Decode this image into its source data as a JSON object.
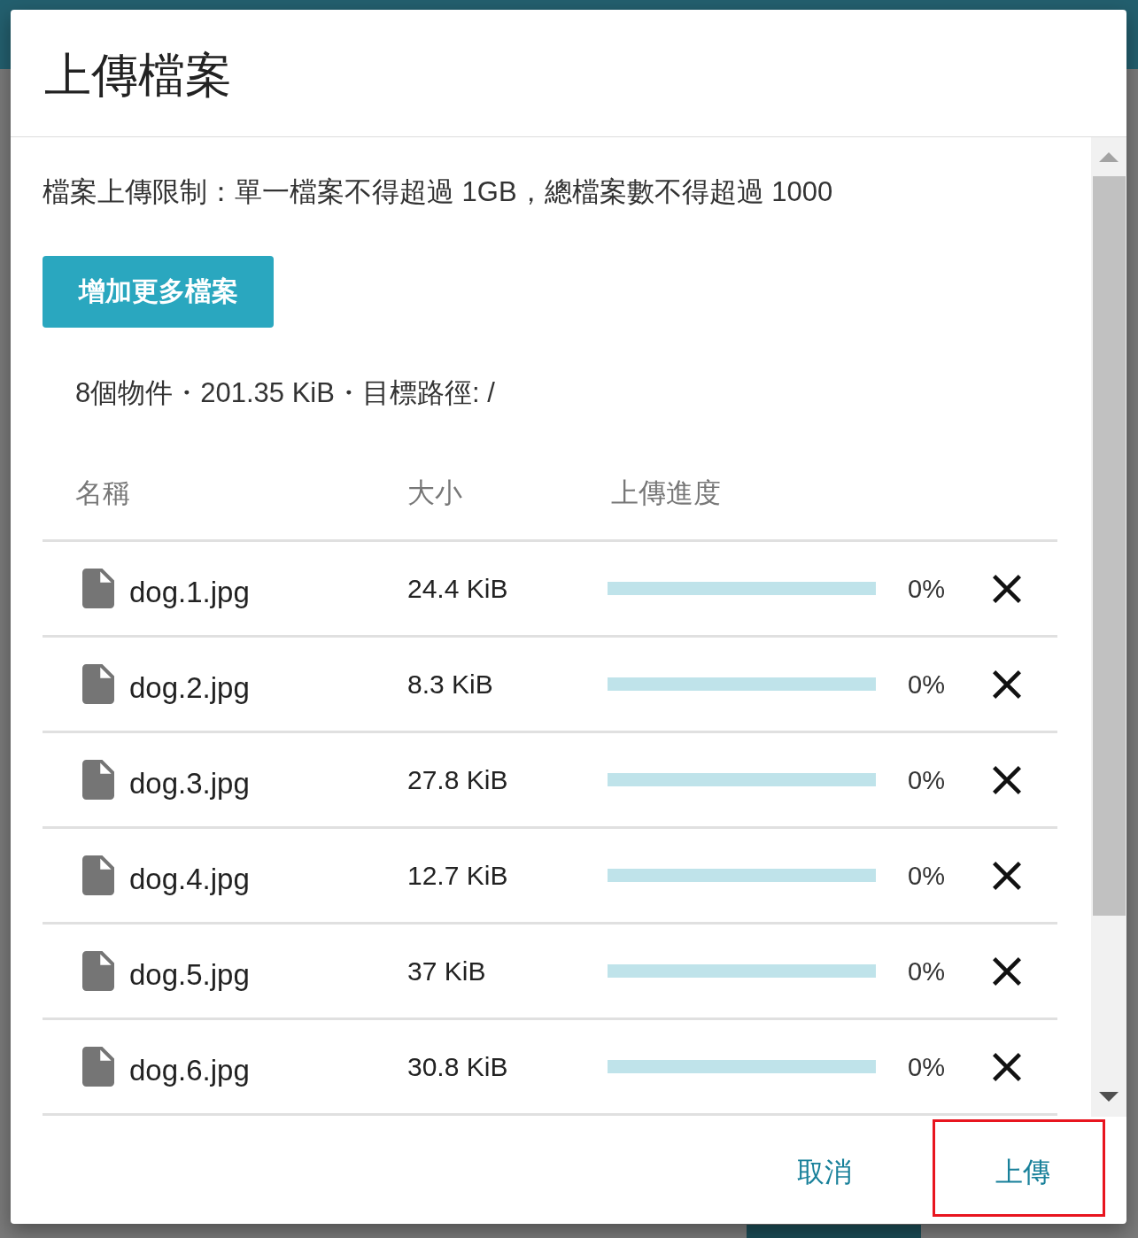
{
  "dialog": {
    "title": "上傳檔案",
    "limit_note": "檔案上傳限制：單一檔案不得超過 1GB，總檔案數不得超過 1000",
    "add_button": "增加更多檔案",
    "summary": "8個物件・201.35 KiB・目標路徑: /"
  },
  "table": {
    "columns": [
      "名稱",
      "大小",
      "上傳進度"
    ],
    "rows": [
      {
        "name": "dog.1.jpg",
        "size": "24.4 KiB",
        "level": 0,
        "reading": "0%"
      },
      {
        "name": "dog.2.jpg",
        "size": "8.3 KiB",
        "level": 0,
        "reading": "0%"
      },
      {
        "name": "dog.3.jpg",
        "size": "27.8 KiB",
        "level": 0,
        "reading": "0%"
      },
      {
        "name": "dog.4.jpg",
        "size": "12.7 KiB",
        "level": 0,
        "reading": "0%"
      },
      {
        "name": "dog.5.jpg",
        "size": "37 KiB",
        "level": 0,
        "reading": "0%"
      },
      {
        "name": "dog.6.jpg",
        "size": "30.8 KiB",
        "level": 0,
        "reading": "0%"
      }
    ]
  },
  "footer_buttons": [
    {
      "label": "取消",
      "highlighted": false
    },
    {
      "label": "上傳",
      "highlighted": true
    }
  ]
}
